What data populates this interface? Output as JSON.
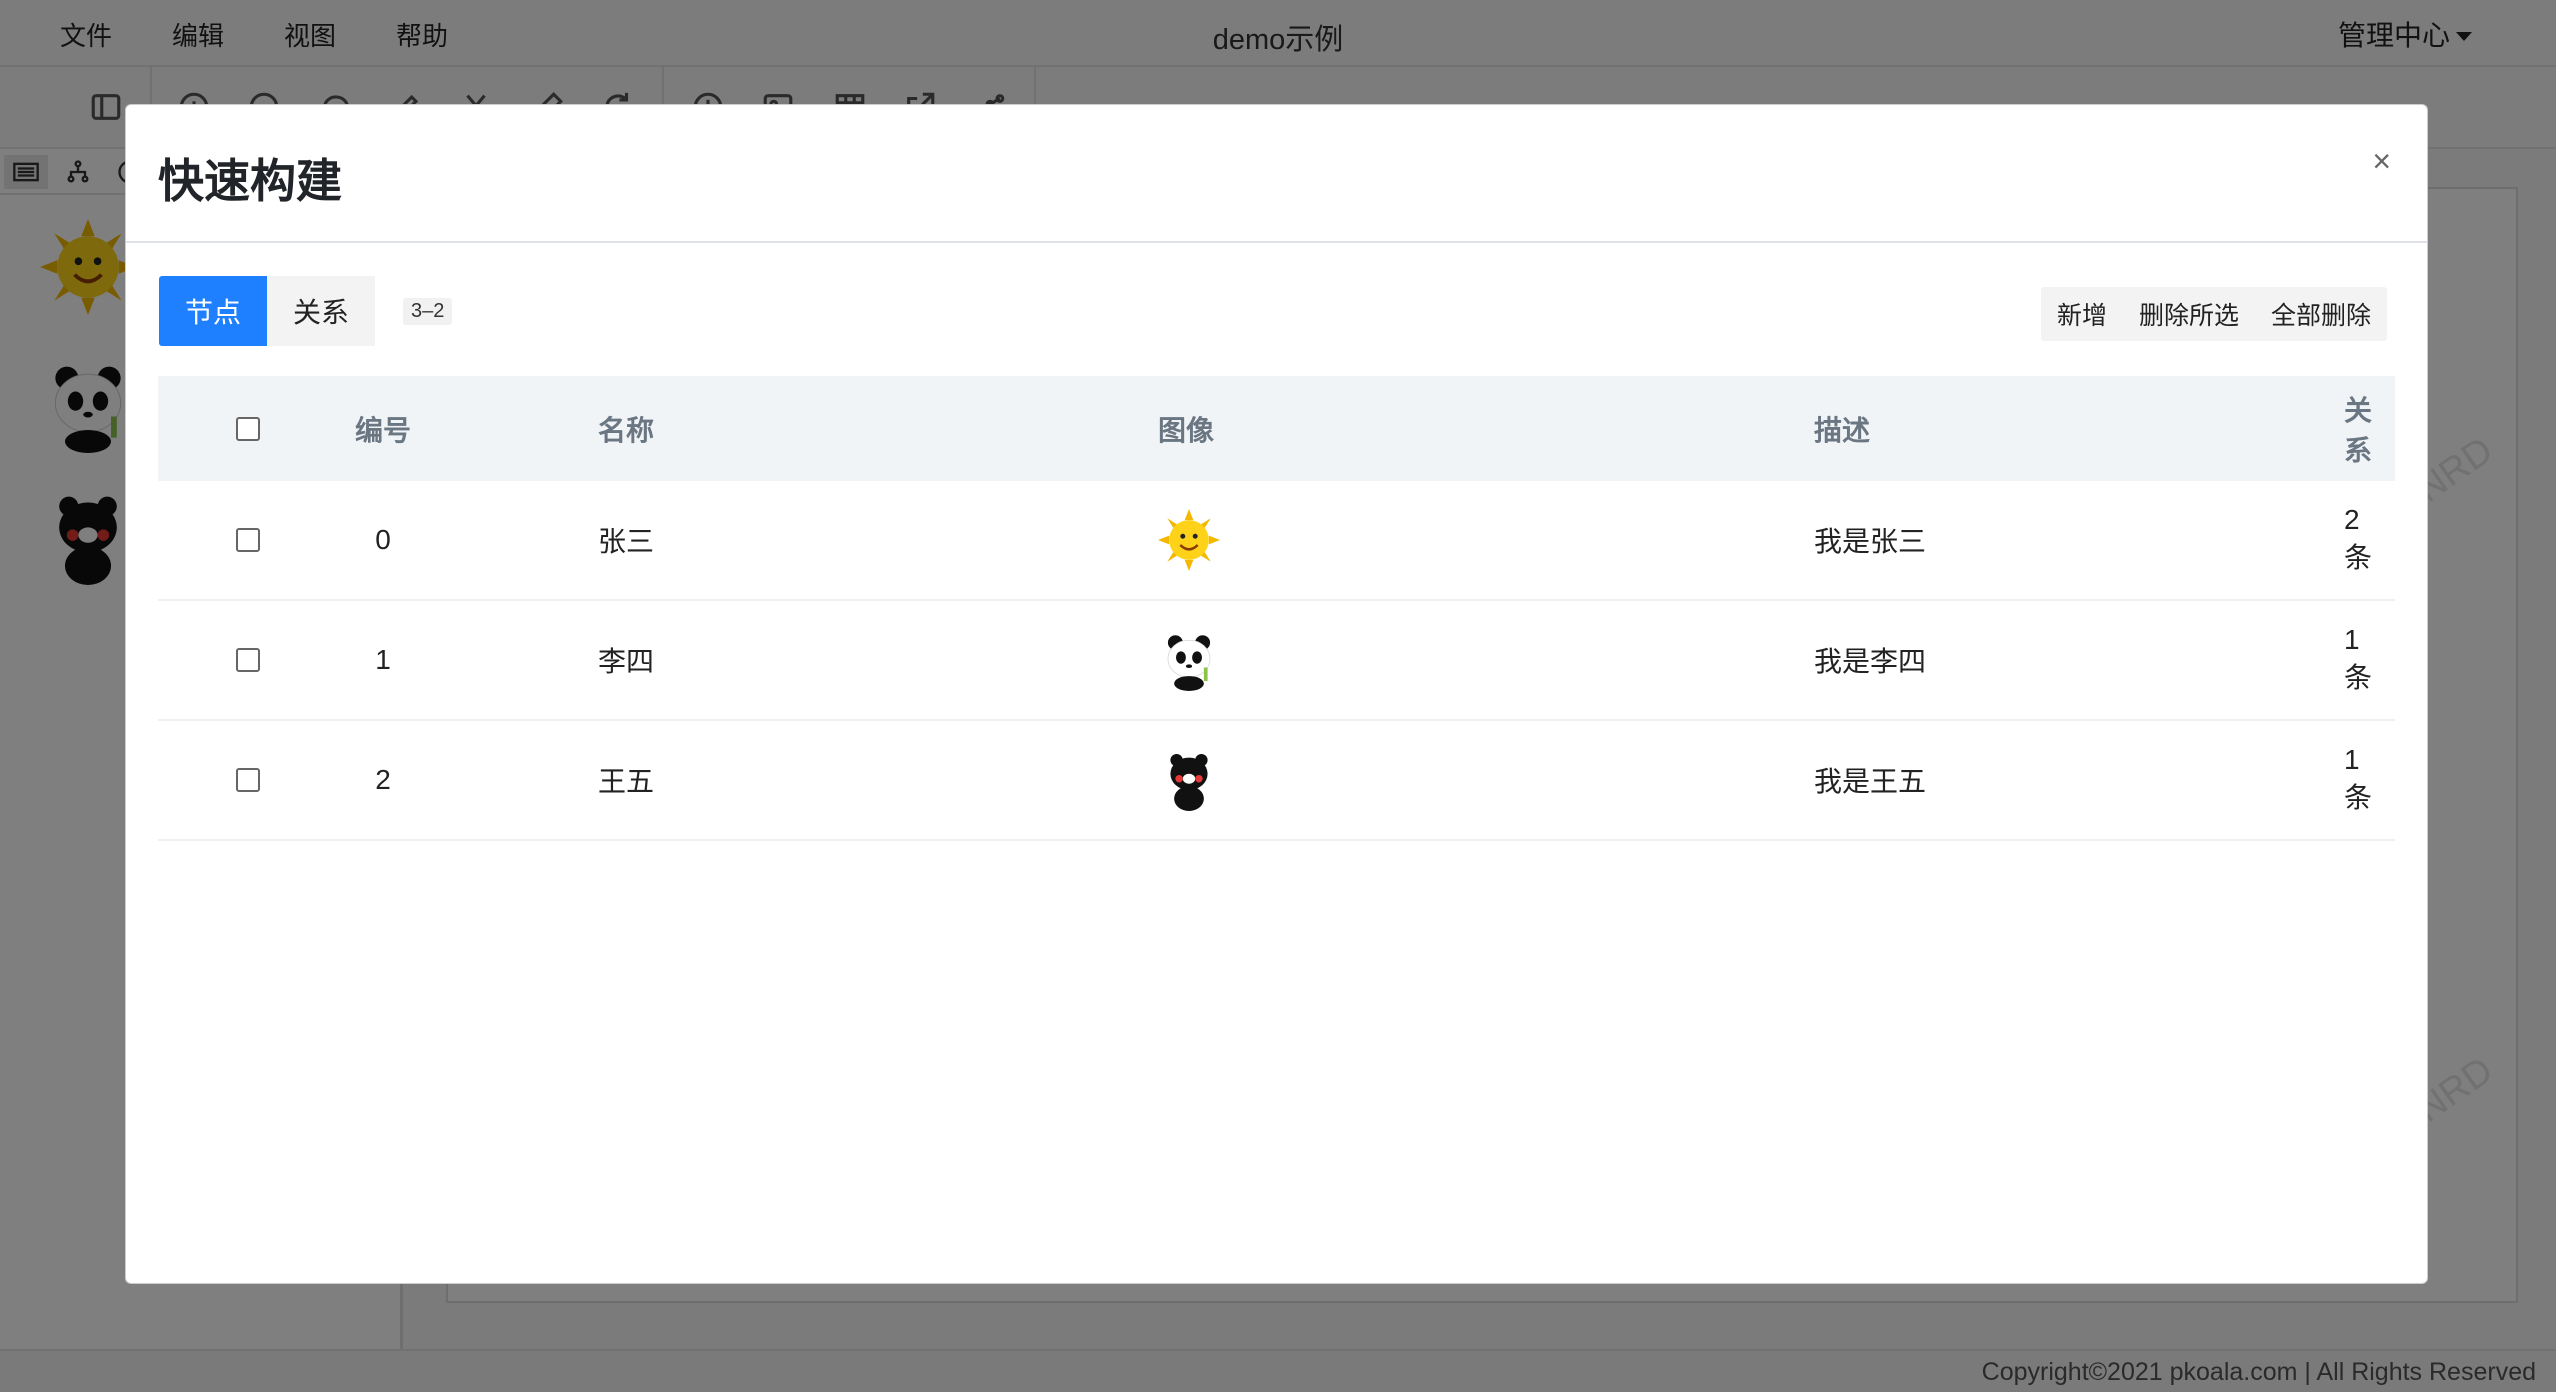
{
  "menubar": {
    "items": [
      "文件",
      "编辑",
      "视图",
      "帮助"
    ],
    "title": "demo示例",
    "admin": "管理中心"
  },
  "toolbar": {
    "icons": [
      "toggle-sidebar-icon",
      "zoom-in-icon",
      "zoom-out-icon",
      "comment-icon",
      "edit-icon",
      "cut-icon",
      "pen-icon",
      "refresh-icon",
      "clock-icon",
      "image-icon",
      "table-icon",
      "export-icon",
      "share-icon"
    ]
  },
  "leftpanel": {
    "tabs": [
      "list-icon",
      "hierarchy-icon",
      "user-icon"
    ],
    "avatars": [
      "sun-avatar",
      "panda-avatar",
      "bear-avatar"
    ]
  },
  "canvas": {
    "watermark": "NRD"
  },
  "statusbar": {
    "copyright": "Copyright©2021 pkoala.com | All Rights Reserved"
  },
  "modal": {
    "title": "快速构建",
    "close": "×",
    "tabs": [
      {
        "label": "节点",
        "active": true
      },
      {
        "label": "关系",
        "active": false
      }
    ],
    "count": "3–2",
    "actions": [
      "新增",
      "删除所选",
      "全部删除"
    ],
    "table": {
      "headers": {
        "id": "编号",
        "name": "名称",
        "image": "图像",
        "desc": "描述",
        "relation": "关系"
      },
      "rows": [
        {
          "id": "0",
          "name": "张三",
          "image": "sun-avatar",
          "desc": "我是张三",
          "relation": "2条"
        },
        {
          "id": "1",
          "name": "李四",
          "image": "panda-avatar",
          "desc": "我是李四",
          "relation": "1条"
        },
        {
          "id": "2",
          "name": "王五",
          "image": "bear-avatar",
          "desc": "我是王五",
          "relation": "1条"
        }
      ]
    }
  },
  "colors": {
    "primary": "#1e80ff",
    "header_bg": "#f1f4f7",
    "backdrop": "rgba(0,0,0,0.5)"
  }
}
